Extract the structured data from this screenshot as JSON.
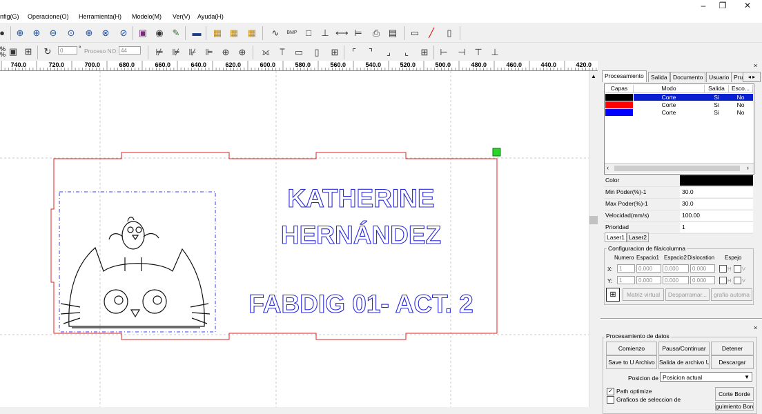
{
  "window": {
    "controls": {
      "minimize": "–",
      "maximize": "❐",
      "close": "✕"
    }
  },
  "menu": [
    "nfig(G)",
    "Operacione(O)",
    "Herramienta(H)",
    "Modelo(M)",
    "Ver(V)",
    "Ayuda(H)"
  ],
  "toolbar2": {
    "angle_value": "0",
    "degree_symbol": "°",
    "proceso_label": "Proceso NO:",
    "proceso_value": "44"
  },
  "ruler": {
    "labels": [
      "740.0",
      "720.0",
      "700.0",
      "680.0",
      "660.0",
      "640.0",
      "620.0",
      "600.0",
      "580.0",
      "560.0",
      "540.0",
      "520.0",
      "500.0",
      "480.0",
      "460.0",
      "440.0",
      "420.0"
    ]
  },
  "design": {
    "line1": "KATHERINE",
    "line2": "HERNÁNDEZ",
    "line3": "FABDIG 01- ACT. 2"
  },
  "panel": {
    "tabs": [
      "Procesamiento",
      "Salida",
      "Documento",
      "Usuario",
      "Pru"
    ],
    "layer_headers": [
      "Capas",
      "Modo",
      "Salida",
      "Esco..."
    ],
    "layers": [
      {
        "color": "#000000",
        "mode": "Corte",
        "output": "Si",
        "select": "No",
        "selected": true
      },
      {
        "color": "#ff0000",
        "mode": "Corte",
        "output": "Si",
        "select": "No",
        "selected": false
      },
      {
        "color": "#0000ff",
        "mode": "Corte",
        "output": "Si",
        "select": "No",
        "selected": false
      }
    ],
    "props": {
      "color_label": "Color",
      "min_label": "Min Poder(%)-1",
      "min_value": "30.0",
      "max_label": "Max Poder(%)-1",
      "max_value": "30.0",
      "speed_label": "Velocidad(mm/s)",
      "speed_value": "100.00",
      "priority_label": "Prioridad",
      "priority_value": "1"
    },
    "laser_tabs": [
      "Laser1",
      "Laser2"
    ],
    "array": {
      "title": "Configuracion de fila/columna",
      "col_num": "Numero",
      "col_s1": "Espacio1",
      "col_s2": "Espacio2",
      "col_disl": "Dislocation",
      "col_mirror": "Espejo",
      "x_label": "X:",
      "y_label": "Y:",
      "x_num": "1",
      "x_s1": "0.000",
      "x_s2": "0.000",
      "x_disl": "0.000",
      "y_num": "1",
      "y_s1": "0.000",
      "y_s2": "0.000",
      "y_disl": "0.000",
      "h_label": "H",
      "v_label": "V",
      "btn_virtual": "Matriz virtual",
      "btn_scatter": "Desparramar...",
      "btn_auto": "grafia automa"
    },
    "data": {
      "title": "Procesamiento de datos",
      "start": "Comienzo",
      "pause": "Pausa/Continuar",
      "stop": "Detener",
      "save_u": "Save to U Archivo",
      "out_u": "Salida de archivo U",
      "download": "Descargar",
      "position_label": "Posicion de",
      "position_value": "Posicion actual",
      "path_opt": "Path optimize",
      "graf_sel": "Graficos de seleccion de",
      "corte_borde": "Corte Borde",
      "more_btn": "guimiento Bord"
    }
  }
}
